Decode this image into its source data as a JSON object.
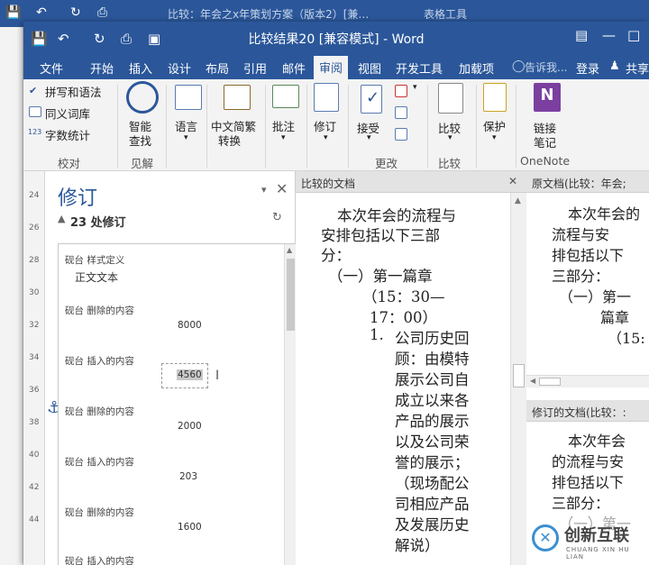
{
  "back_window": {
    "title": "比较：年会之x年策划方案（版本2）[兼…",
    "context_tab": "表格工具"
  },
  "titlebar": {
    "title": "比较结果20 [兼容模式] - Word",
    "quick_access": [
      "保存",
      "撤销",
      "重复",
      "打印预览",
      "触摸模式"
    ]
  },
  "tabs": [
    {
      "label": "文件"
    },
    {
      "label": "开始"
    },
    {
      "label": "插入"
    },
    {
      "label": "设计"
    },
    {
      "label": "布局"
    },
    {
      "label": "引用"
    },
    {
      "label": "邮件"
    },
    {
      "label": "审阅"
    },
    {
      "label": "视图"
    },
    {
      "label": "开发工具"
    },
    {
      "label": "加载项"
    },
    {
      "label": "告诉我..."
    },
    {
      "label": "登录"
    },
    {
      "label": "共享"
    }
  ],
  "ribbon": {
    "proofing": {
      "spelling": "拼写和语法",
      "thesaurus": "同义词库",
      "wordcount": "字数统计",
      "group": "校对"
    },
    "insights": {
      "smart_lookup_1": "智能",
      "smart_lookup_2": "查找",
      "group": "见解"
    },
    "language": {
      "label": "语言"
    },
    "chinese": {
      "label_1": "中文简繁",
      "label_2": "转换"
    },
    "comments": {
      "label": "批注"
    },
    "tracking": {
      "label": "修订"
    },
    "changes": {
      "accept": "接受",
      "group": "更改"
    },
    "compare": {
      "label": "比较",
      "group": "比较"
    },
    "protect": {
      "label": "保护"
    },
    "onenote": {
      "label_1": "链接",
      "label_2": "笔记",
      "group": "OneNote"
    }
  },
  "revisions": {
    "title": "修订",
    "count": "23 处修订",
    "items": [
      {
        "head": "砚台 样式定义",
        "value": "正文文本"
      },
      {
        "head": "砚台 删除的内容",
        "value": "8000"
      },
      {
        "head": "砚台 插入的内容",
        "value": "4560"
      },
      {
        "head": "砚台 删除的内容",
        "value": "2000"
      },
      {
        "head": "砚台 插入的内容",
        "value": "203"
      },
      {
        "head": "砚台 删除的内容",
        "value": "1600"
      },
      {
        "head": "砚台 插入的内容",
        "value": ""
      }
    ]
  },
  "compared_doc": {
    "header": "比较的文档",
    "lines": [
      "本次年会的流程与",
      "安排包括以下三部",
      "分：",
      "（一）第一篇章",
      "（15：30—",
      "17：00）",
      "1.",
      "公司历史回",
      "顾：由模特",
      "展示公司自",
      "成立以来各",
      "产品的展示",
      "以及公司荣",
      "誉的展示；",
      "（现场配公",
      "司相应产品",
      "及发展历史",
      "解说）"
    ]
  },
  "original_doc": {
    "header": "原文档(比较：年会;",
    "lines": [
      "本次年会的",
      "流程与安",
      "排包括以下",
      "三部分：",
      "（一）第一",
      "篇章",
      "（15:"
    ]
  },
  "revised_doc": {
    "header": "修订的文档(比较：:",
    "lines": [
      "本次年会",
      "的流程与安",
      "排包括以下",
      "三部分：",
      "（一）第一"
    ]
  },
  "ruler_numbers": [
    "24",
    "26",
    "28",
    "30",
    "32",
    "34",
    "36",
    "38",
    "40",
    "42",
    "44"
  ],
  "watermark": {
    "name": "创新互联",
    "sub": "CHUANG XIN HU LIAN"
  }
}
